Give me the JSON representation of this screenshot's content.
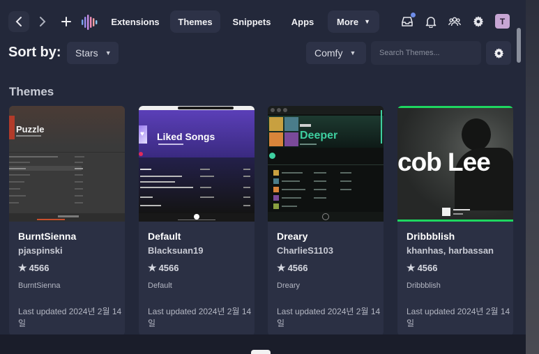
{
  "nav": {
    "tabs": [
      {
        "label": "Extensions"
      },
      {
        "label": "Themes"
      },
      {
        "label": "Snippets"
      },
      {
        "label": "Apps"
      },
      {
        "label": "More"
      }
    ],
    "avatar_initial": "T"
  },
  "toolbar": {
    "sort_label": "Sort by:",
    "sort_value": "Stars",
    "view_value": "Comfy",
    "search_placeholder": "Search Themes..."
  },
  "section_title": "Themes",
  "cards": [
    {
      "title": "BurntSienna",
      "author": "pjaspinski",
      "stars": "4566",
      "tag": "BurntSienna",
      "updated": "Last updated 2024년 2월 14일",
      "preview_text": "Puzzle"
    },
    {
      "title": "Default",
      "author": "Blacksuan19",
      "stars": "4566",
      "tag": "Default",
      "updated": "Last updated 2024년 2월 14일",
      "preview_text": "Liked Songs"
    },
    {
      "title": "Dreary",
      "author": "CharlieS1103",
      "stars": "4566",
      "tag": "Dreary",
      "updated": "Last updated 2024년 2월 14일",
      "preview_text": "Deeper"
    },
    {
      "title": "Dribbblish",
      "author": "khanhas, harbassan",
      "stars": "4566",
      "tag": "Dribbblish",
      "updated": "Last updated 2024년 2월 14일",
      "preview_text": "cob Lee"
    }
  ],
  "colors": {
    "background": "#23283a",
    "surface": "#2d3247",
    "card": "#2b3044",
    "notification_dot": "#6e8de8",
    "avatar": "#c7a6d4",
    "dribbblish_accent": "#1ed760"
  }
}
